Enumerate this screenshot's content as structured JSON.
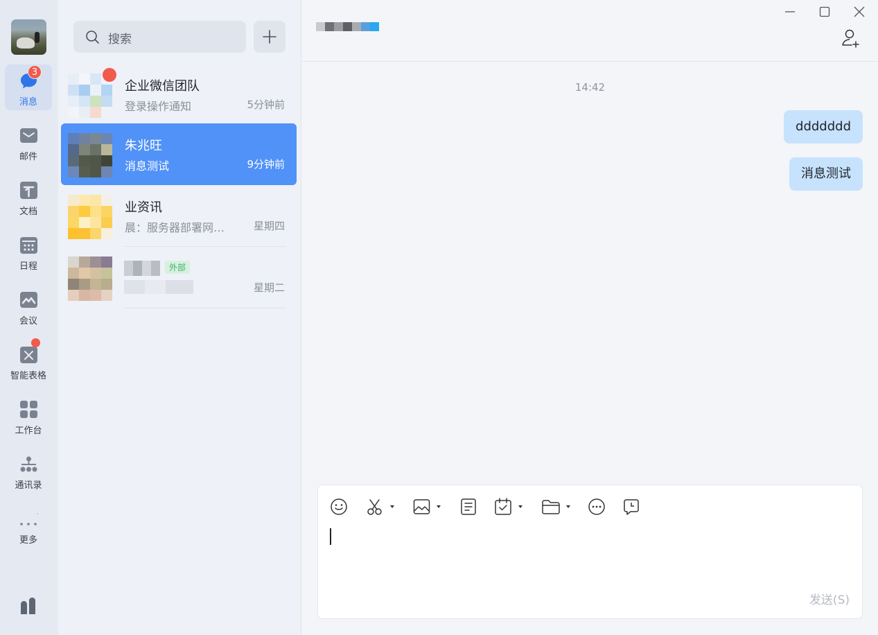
{
  "nav": {
    "items": [
      {
        "label": "消息",
        "badge": "3",
        "active": true,
        "icon": "chat-bubble-icon"
      },
      {
        "label": "邮件",
        "icon": "mail-icon"
      },
      {
        "label": "文档",
        "icon": "document-icon"
      },
      {
        "label": "日程",
        "icon": "calendar-icon"
      },
      {
        "label": "会议",
        "icon": "meeting-icon"
      },
      {
        "label": "智能表格",
        "icon": "smart-sheet-icon"
      },
      {
        "label": "工作台",
        "icon": "workbench-grid-icon"
      },
      {
        "label": "通讯录",
        "icon": "org-chart-icon"
      },
      {
        "label": "更多",
        "icon": "more-dots-icon"
      }
    ]
  },
  "search": {
    "placeholder": "搜索"
  },
  "conversations": [
    {
      "name": "企业微信团队",
      "preview": "登录操作通知",
      "time": "5分钟前"
    },
    {
      "name": "朱兆旺",
      "preview": "消息测试",
      "time": "9分钟前",
      "active": true
    },
    {
      "name": "业资讯",
      "preview": "晨：服务器部署网…",
      "time": "星期四"
    },
    {
      "name": "",
      "preview": "",
      "time": "星期二",
      "tag": "外部"
    }
  ],
  "chat": {
    "timestamp": "14:42",
    "messages": [
      {
        "text": "ddddddd",
        "from": "self"
      },
      {
        "text": "消息测试",
        "from": "self"
      }
    ],
    "send_label": "发送(S)"
  },
  "colors": {
    "accent": "#5092f8",
    "bubble": "#c6e2fd",
    "badge": "#f25a4c"
  }
}
